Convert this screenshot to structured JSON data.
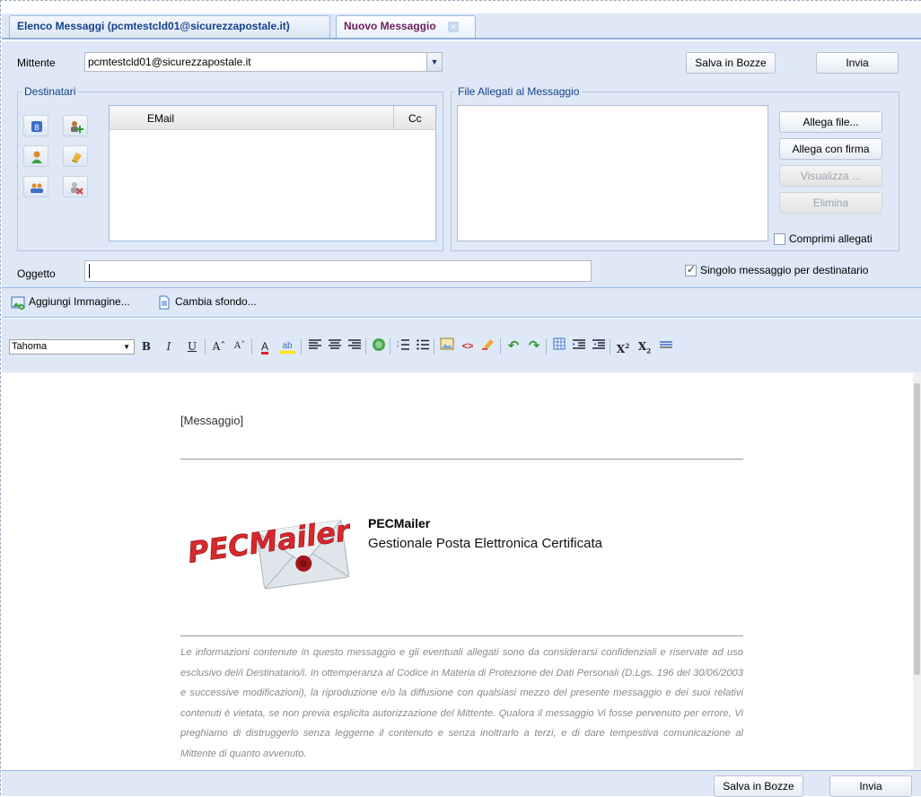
{
  "tabs": [
    {
      "label": "Elenco Messaggi (pcmtestcld01@sicurezzapostale.it)"
    },
    {
      "label": "Nuovo Messaggio"
    }
  ],
  "form": {
    "sender_label": "Mittente",
    "sender_value": "pcmtestcld01@sicurezzapostale.it",
    "save_draft": "Salva in Bozze",
    "send": "Invia",
    "recipients_legend": "Destinatari",
    "grid_col_email": "EMail",
    "grid_col_cc": "Cc",
    "attachments_legend": "File Allegati al Messaggio",
    "attach_file": "Allega file...",
    "attach_signed": "Allega con firma",
    "view": "Visualizza ...",
    "delete": "Elimina",
    "compress": "Comprimi allegati",
    "subject_label": "Oggetto",
    "subject_value": "",
    "single_msg": "Singolo messaggio per destinatario",
    "single_msg_checked": true,
    "compress_checked": false
  },
  "toolbar": {
    "add_image": "Aggiungi Immagine...",
    "change_bg": "Cambia sfondo...",
    "font": "Tahoma"
  },
  "editor": {
    "message_placeholder": "[Messaggio]",
    "logo_text": "PECMailer",
    "brand": "PECMailer",
    "subtitle": "Gestionale Posta Elettronica Certificata",
    "disclaimer": "Le informazioni contenute in questo messaggio e gli eventuali allegati sono da considerarsi confidenziali e riservate ad uso esclusivo del/i Destinatario/i. In ottemperanza al Codice in Materia di Protezione dei Dati Personali (D.Lgs. 196 del 30/06/2003 e successive modificazioni), la riproduzione e/o la diffusione con qualsiasi mezzo del presente messaggio e dei suoi relativi contenuti è vietata, se non previa esplicita autorizzazione del Mittente. Qualora il messaggio Vi fosse pervenuto per errore, Vi preghiamo di distruggerlo senza leggerne il contenuto e senza inoltrarlo a terzi, e di dare tempestiva comunicazione al Mittente di quanto avvenuto."
  },
  "footer": {
    "save_draft": "Salva in Bozze",
    "send": "Invia"
  }
}
